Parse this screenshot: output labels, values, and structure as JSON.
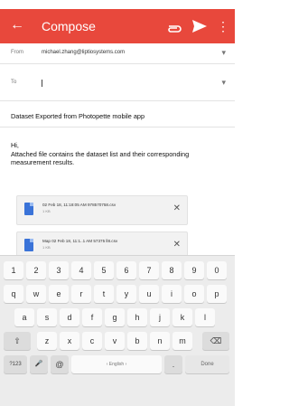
{
  "appbar": {
    "title": "Compose",
    "icons": [
      "arrow-back-icon",
      "paperclip-icon",
      "send-icon",
      "more-vertical-icon"
    ],
    "color": "#e8483c"
  },
  "from": {
    "label": "From",
    "value": "michael.zhang@liptiosystems.com"
  },
  "to": {
    "label": "To",
    "value": ""
  },
  "subject": "Dataset Exported from Photopette mobile app",
  "body": {
    "greeting": "Hi,",
    "line": "Attached file contains the dataset list and their corresponding measurement results."
  },
  "attachments": [
    {
      "name": "02 Feb 18, 11:18:05 AM 978570758.csv",
      "size": "1 KB"
    },
    {
      "name": "Map 02 Feb 18, 11:1..1 AM 57375 ll8.csv",
      "size": "1 KB"
    }
  ],
  "keyboard": {
    "row1": [
      "1",
      "2",
      "3",
      "4",
      "5",
      "6",
      "7",
      "8",
      "9",
      "0"
    ],
    "row2": [
      "q",
      "w",
      "e",
      "r",
      "t",
      "y",
      "u",
      "i",
      "o",
      "p"
    ],
    "row3": [
      "a",
      "s",
      "d",
      "f",
      "g",
      "h",
      "j",
      "k",
      "l"
    ],
    "row4": [
      "z",
      "x",
      "c",
      "v",
      "b",
      "n",
      "m"
    ],
    "shift": "⇧",
    "backspace": "⌫",
    "mode": "?123",
    "mic": "🎤",
    "at": "@",
    "space": "‹ English ›",
    "period": ".",
    "done": "Done"
  }
}
